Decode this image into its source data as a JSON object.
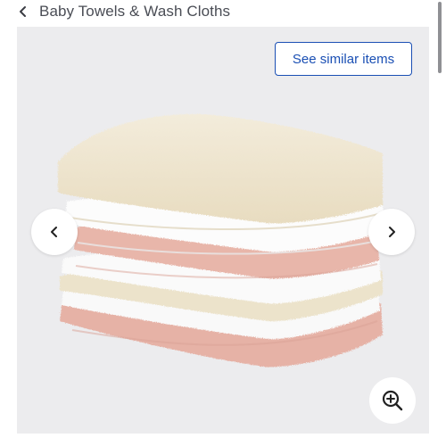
{
  "breadcrumb": {
    "label": "Baby Towels & Wash Cloths",
    "icon": "chevron-left-icon"
  },
  "gallery": {
    "similar_button_label": "See similar items",
    "image_subject": "stack-of-washcloths",
    "prev_icon": "chevron-left-icon",
    "next_icon": "chevron-right-icon",
    "zoom_icon": "zoom-in-icon"
  },
  "colors": {
    "accent": "#1a4fb4",
    "gallery_bg": "#ececee",
    "towel_cream": "#eee5cf",
    "towel_white": "#fbfbfb",
    "towel_pink": "#e9b9ad"
  }
}
